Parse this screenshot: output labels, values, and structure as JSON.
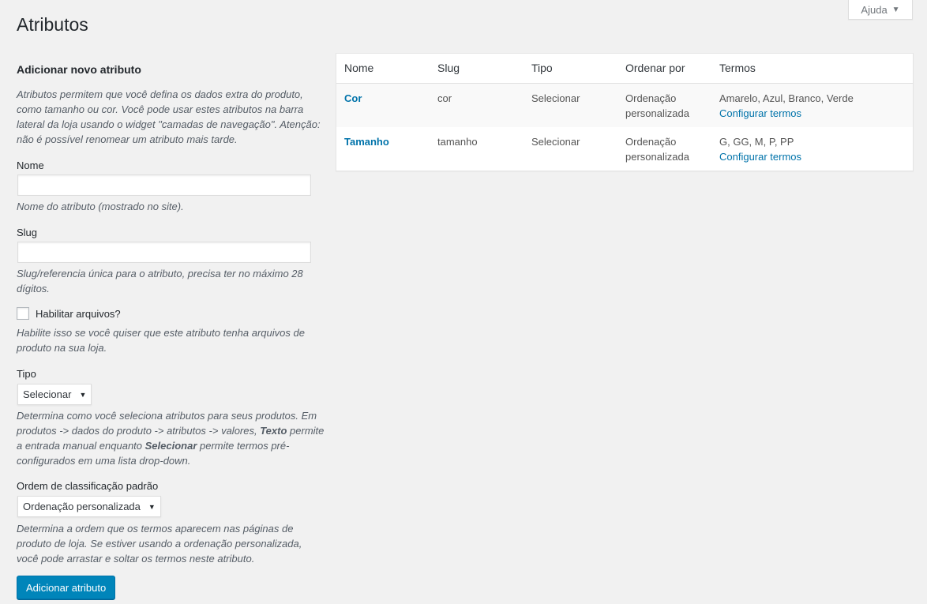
{
  "header": {
    "title": "Atributos",
    "help_label": "Ajuda"
  },
  "form": {
    "heading": "Adicionar novo atributo",
    "intro": "Atributos permitem que você defina os dados extra do produto, como tamanho ou cor. Você pode usar estes atributos na barra lateral da loja usando o widget \"camadas de navegação\". Atenção: não é possível renomear um atributo mais tarde.",
    "name_label": "Nome",
    "name_value": "",
    "name_desc": "Nome do atributo (mostrado no site).",
    "slug_label": "Slug",
    "slug_value": "",
    "slug_desc": "Slug/referencia única para o atributo, precisa ter no máximo 28 dígitos.",
    "archives_label": "Habilitar arquivos?",
    "archives_checked": false,
    "archives_desc": "Habilite isso se você quiser que este atributo tenha arquivos de produto na sua loja.",
    "type_label": "Tipo",
    "type_value": "Selecionar",
    "type_desc_1": "Determina como você seleciona atributos para seus produtos. Em produtos -> dados do produto -> atributos -> valores, ",
    "type_desc_bold_1": "Texto",
    "type_desc_2": " permite a entrada manual enquanto ",
    "type_desc_bold_2": "Selecionar",
    "type_desc_3": " permite termos pré-configurados em uma lista drop-down.",
    "order_label": "Ordem de classificação padrão",
    "order_value": "Ordenação personalizada",
    "order_desc": "Determina a ordem que os termos aparecem nas páginas de produto de loja. Se estiver usando a ordenação personalizada, você pode arrastar e soltar os termos neste atributo.",
    "submit_label": "Adicionar atributo"
  },
  "table": {
    "columns": [
      "Nome",
      "Slug",
      "Tipo",
      "Ordenar por",
      "Termos"
    ],
    "rows": [
      {
        "name": "Cor",
        "slug": "cor",
        "type": "Selecionar",
        "order": "Ordenação personalizada",
        "terms": "Amarelo, Azul, Branco, Verde",
        "configure_label": "Configurar termos"
      },
      {
        "name": "Tamanho",
        "slug": "tamanho",
        "type": "Selecionar",
        "order": "Ordenação personalizada",
        "terms": "G, GG, M, P, PP",
        "configure_label": "Configurar termos"
      }
    ]
  },
  "colors": {
    "accent": "#0073aa",
    "button_bg": "#0085ba",
    "page_bg": "#f1f1f1"
  }
}
